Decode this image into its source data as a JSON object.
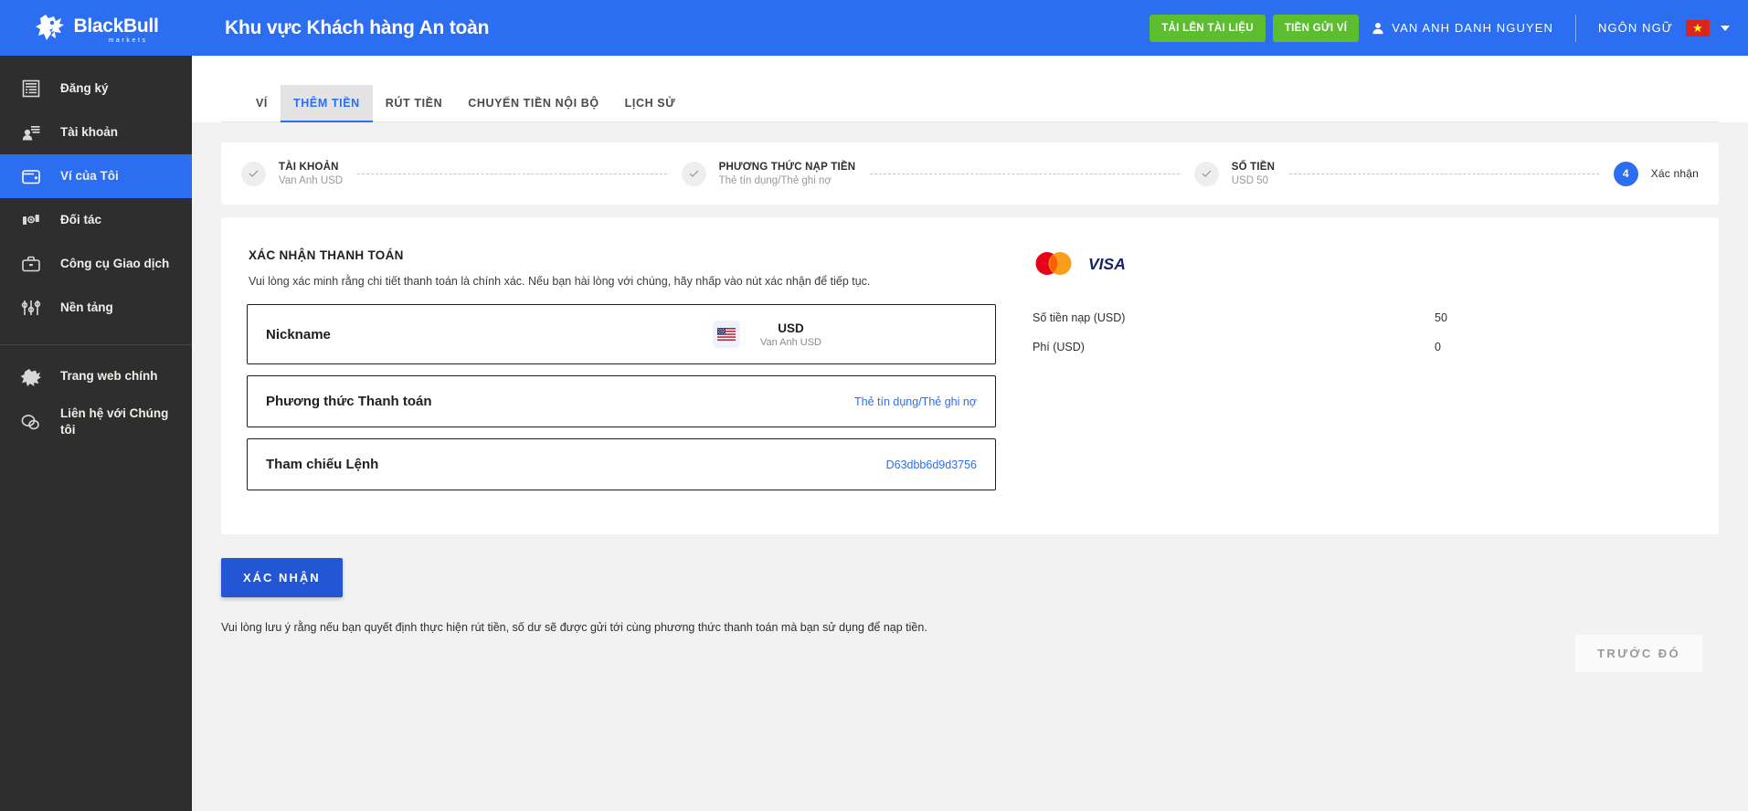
{
  "header": {
    "logo_name": "BlackBull",
    "logo_sub": "markets",
    "title": "Khu vực Khách hàng An toàn",
    "upload_button": "TẢI LÊN TÀI LIỆU",
    "deposit_button": "TIỀN GỬI VÍ",
    "user_name": "VAN ANH DANH NGUYEN",
    "language_label": "NGÔN NGỮ",
    "flag_star": "★",
    "accent_blue": "#2c6ef2",
    "green": "#5cbd2e",
    "flag_red": "#da251d"
  },
  "sidebar": {
    "items": [
      {
        "label": "Đăng ký",
        "icon": "registration-icon",
        "active": false
      },
      {
        "label": "Tài khoản",
        "icon": "account-icon",
        "active": false
      },
      {
        "label": "Ví của Tôi",
        "icon": "wallet-icon",
        "active": true
      },
      {
        "label": "Đối tác",
        "icon": "partners-icon",
        "active": false
      },
      {
        "label": "Công cụ Giao dịch",
        "icon": "briefcase-icon",
        "active": false
      },
      {
        "label": "Nền tảng",
        "icon": "sliders-icon",
        "active": false
      }
    ],
    "bottom_items": [
      {
        "label": "Trang web chính",
        "icon": "bull-icon"
      },
      {
        "label": "Liên hệ với Chúng tôi",
        "icon": "chat-icon"
      }
    ]
  },
  "tabs": [
    {
      "label": "VÍ",
      "active": false
    },
    {
      "label": "THÊM TIỀN",
      "active": true
    },
    {
      "label": "RÚT TIỀN",
      "active": false
    },
    {
      "label": "CHUYỂN TIỀN NỘI BỘ",
      "active": false
    },
    {
      "label": "LỊCH SỬ",
      "active": false
    }
  ],
  "stepper": [
    {
      "number": "1",
      "title": "TÀI KHOẢN",
      "sub": "Van Anh USD",
      "state": "done"
    },
    {
      "number": "2",
      "title": "PHƯƠNG THỨC NẠP TIỀN",
      "sub": "Thẻ tín dụng/Thẻ ghi nợ",
      "state": "done"
    },
    {
      "number": "3",
      "title": "SỐ TIỀN",
      "sub": "USD 50",
      "state": "done"
    },
    {
      "number": "4",
      "title": "Xác nhận",
      "sub": "",
      "state": "active"
    }
  ],
  "content": {
    "section_title": "XÁC NHẬN THANH TOÁN",
    "section_desc": "Vui lòng xác minh rằng chi tiết thanh toán là chính xác. Nếu bạn hài lòng với chúng, hãy nhấp vào nút xác nhận để tiếp tục.",
    "rows": [
      {
        "label": "Nickname",
        "type": "currency",
        "currency_code": "USD",
        "currency_sub": "Van Anh USD",
        "flag": "us-flag-icon"
      },
      {
        "label": "Phương thức Thanh toán",
        "type": "link",
        "value": "Thẻ tín dụng/Thẻ ghi nợ"
      },
      {
        "label": "Tham chiếu Lệnh",
        "type": "link",
        "value": "D63dbb6d9d3756"
      }
    ],
    "card_logos": [
      "mastercard-logo",
      "visa-logo"
    ],
    "amounts": [
      {
        "label": "Số tiền nạp (USD)",
        "value": "50"
      },
      {
        "label": "Phí (USD)",
        "value": "0"
      }
    ]
  },
  "actions": {
    "confirm_label": "XÁC NHẬN",
    "previous_label": "TRƯỚC ĐÓ",
    "footer_note": "Vui lòng lưu ý rằng nếu bạn quyết định thực hiện rút tiền, số dư sẽ được gửi tới cùng phương thức thanh toán mà bạn sử dụng để nạp tiền."
  }
}
